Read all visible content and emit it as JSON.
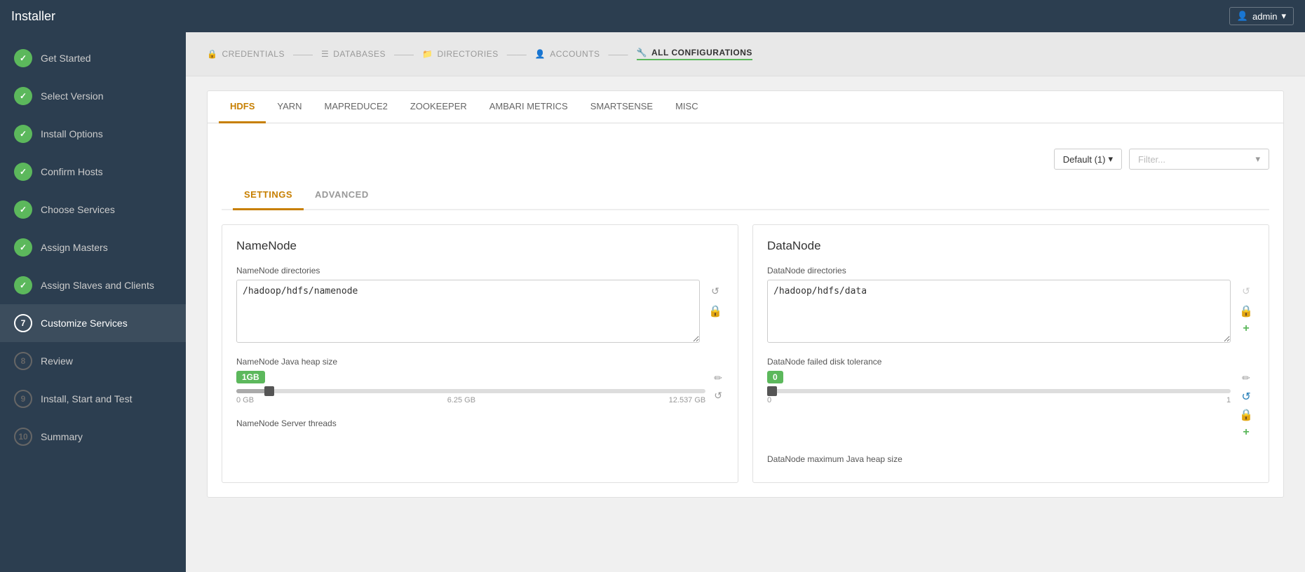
{
  "topbar": {
    "title": "Installer",
    "user_label": "admin",
    "user_icon": "👤"
  },
  "breadcrumbs": [
    {
      "id": "credentials",
      "label": "CREDENTIALS",
      "icon": "🔒",
      "active": false
    },
    {
      "id": "databases",
      "label": "DATABASES",
      "icon": "☰",
      "active": false
    },
    {
      "id": "directories",
      "label": "DIRECTORIES",
      "icon": "📁",
      "active": false
    },
    {
      "id": "accounts",
      "label": "ACCOUNTS",
      "icon": "👤",
      "active": false
    },
    {
      "id": "all-configurations",
      "label": "ALL CONFIGURATIONS",
      "icon": "🔧",
      "active": true
    }
  ],
  "sidebar": {
    "items": [
      {
        "id": "get-started",
        "label": "Get Started",
        "step": "✓",
        "state": "done"
      },
      {
        "id": "select-version",
        "label": "Select Version",
        "step": "✓",
        "state": "done"
      },
      {
        "id": "install-options",
        "label": "Install Options",
        "step": "✓",
        "state": "done"
      },
      {
        "id": "confirm-hosts",
        "label": "Confirm Hosts",
        "step": "✓",
        "state": "done"
      },
      {
        "id": "choose-services",
        "label": "Choose Services",
        "step": "✓",
        "state": "done"
      },
      {
        "id": "assign-masters",
        "label": "Assign Masters",
        "step": "✓",
        "state": "done"
      },
      {
        "id": "assign-slaves",
        "label": "Assign Slaves and Clients",
        "step": "✓",
        "state": "done"
      },
      {
        "id": "customize-services",
        "label": "Customize Services",
        "step": "7",
        "state": "current"
      },
      {
        "id": "review",
        "label": "Review",
        "step": "8",
        "state": "pending"
      },
      {
        "id": "install-start-test",
        "label": "Install, Start and Test",
        "step": "9",
        "state": "pending"
      },
      {
        "id": "summary",
        "label": "Summary",
        "step": "10",
        "state": "pending"
      }
    ]
  },
  "service_tabs": [
    {
      "id": "hdfs",
      "label": "HDFS",
      "active": true
    },
    {
      "id": "yarn",
      "label": "YARN",
      "active": false
    },
    {
      "id": "mapreduce2",
      "label": "MAPREDUCE2",
      "active": false
    },
    {
      "id": "zookeeper",
      "label": "ZOOKEEPER",
      "active": false
    },
    {
      "id": "ambari-metrics",
      "label": "AMBARI METRICS",
      "active": false
    },
    {
      "id": "smartsense",
      "label": "SMARTSENSE",
      "active": false
    },
    {
      "id": "misc",
      "label": "MISC",
      "active": false
    }
  ],
  "controls": {
    "group_dropdown": "Default (1)",
    "filter_placeholder": "Filter..."
  },
  "config_tabs": [
    {
      "id": "settings",
      "label": "SETTINGS",
      "active": true
    },
    {
      "id": "advanced",
      "label": "ADVANCED",
      "active": false
    }
  ],
  "namenode": {
    "title": "NameNode",
    "directories_label": "NameNode directories",
    "directories_value": "/hadoop/hdfs/namenode",
    "heap_label": "NameNode Java heap size",
    "heap_badge": "1GB",
    "heap_min": "0 GB",
    "heap_mid": "6.25 GB",
    "heap_max": "12.537 GB",
    "heap_percent": 8,
    "threads_label": "NameNode Server threads"
  },
  "datanode": {
    "title": "DataNode",
    "directories_label": "DataNode directories",
    "directories_value": "/hadoop/hdfs/data",
    "disk_tolerance_label": "DataNode failed disk tolerance",
    "disk_badge": "0",
    "disk_min": "0",
    "disk_max": "1",
    "disk_percent": 0,
    "heap_label": "DataNode maximum Java heap size"
  }
}
